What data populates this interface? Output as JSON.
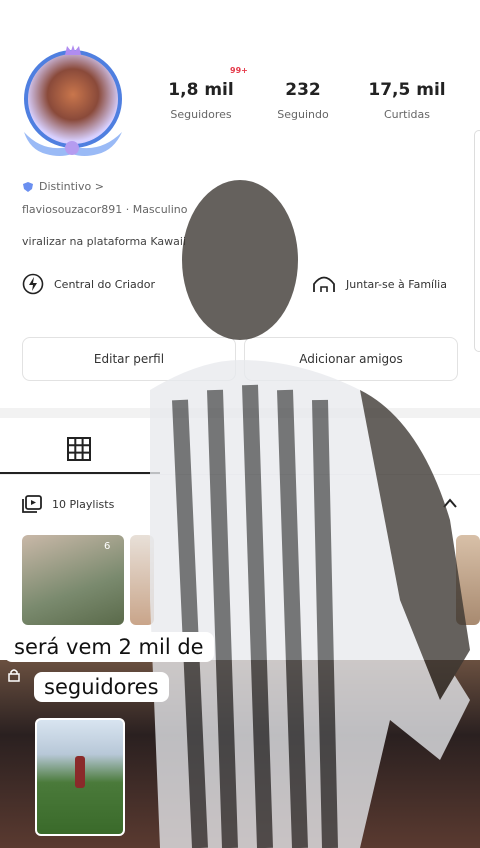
{
  "stats": [
    {
      "value": "1,8 mil",
      "label": "Seguidores"
    },
    {
      "value": "232",
      "label": "Seguindo"
    },
    {
      "value": "17,5 mil",
      "label": "Curtidas"
    }
  ],
  "notification_badge": "99+",
  "badge_link": "Distintivo >",
  "username_line": "flaviosouzacor891 · Masculino",
  "bio": "viralizar na plataforma Kawaii",
  "actions": {
    "creator_center": "Central do Criador",
    "join_family": "Juntar-se à Família",
    "edit_profile": "Editar perfil",
    "add_friends": "Adicionar amigos"
  },
  "playlists_label": "10 Playlists",
  "playlist_count_badge": "6",
  "caption_line1": "será vem 2 mil de",
  "caption_line2": "seguidores",
  "colors": {
    "accent": "#4f7fe0",
    "badge": "#e53a4a"
  }
}
